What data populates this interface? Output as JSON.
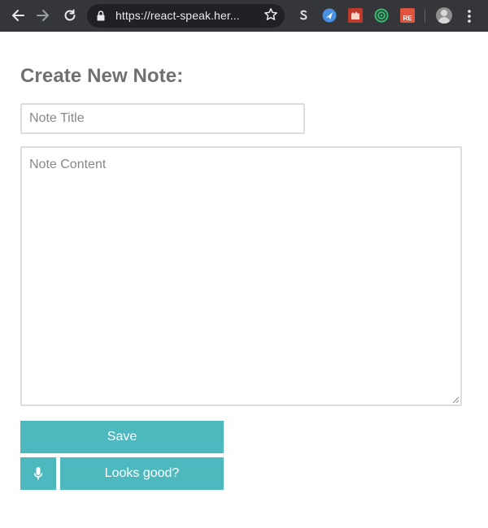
{
  "browser": {
    "url": "https://react-speak.her...",
    "colors": {
      "toolbar": "#35363a",
      "omnibox": "#202124"
    },
    "extensions": [
      "s-extension-icon",
      "paper-plane-extension-icon",
      "red-castle-extension-icon",
      "green-target-extension-icon",
      "re-extension-icon"
    ],
    "re_badge": "RE"
  },
  "page": {
    "title": "Create New Note:",
    "title_field": {
      "placeholder": "Note Title",
      "value": ""
    },
    "content_field": {
      "placeholder": "Note Content",
      "value": ""
    },
    "buttons": {
      "save": "Save",
      "looks_good": "Looks good?"
    },
    "icons": {
      "mic": "microphone-icon"
    },
    "colors": {
      "accent": "#4db8be",
      "heading": "#707070",
      "border": "#dcdcdc"
    }
  }
}
